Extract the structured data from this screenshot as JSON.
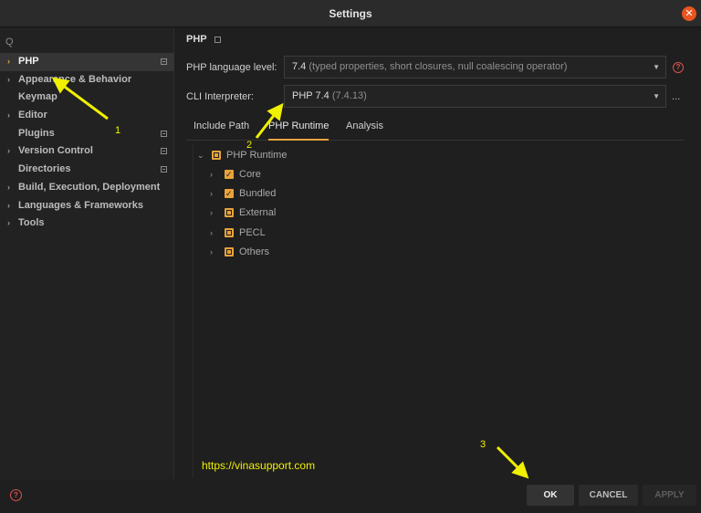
{
  "window": {
    "title": "Settings",
    "close_glyph": "✕"
  },
  "sidebar": {
    "search_icon": "Q",
    "items": [
      {
        "label": "PHP",
        "has_chevron": true,
        "selected": true,
        "has_badge": true
      },
      {
        "label": "Appearance & Behavior",
        "has_chevron": true,
        "selected": false,
        "has_badge": false
      },
      {
        "label": "Keymap",
        "has_chevron": false,
        "selected": false,
        "has_badge": false
      },
      {
        "label": "Editor",
        "has_chevron": true,
        "selected": false,
        "has_badge": false
      },
      {
        "label": "Plugins",
        "has_chevron": false,
        "selected": false,
        "has_badge": true
      },
      {
        "label": "Version Control",
        "has_chevron": true,
        "selected": false,
        "has_badge": true
      },
      {
        "label": "Directories",
        "has_chevron": false,
        "selected": false,
        "has_badge": true
      },
      {
        "label": "Build, Execution, Deployment",
        "has_chevron": true,
        "selected": false,
        "has_badge": false
      },
      {
        "label": "Languages & Frameworks",
        "has_chevron": true,
        "selected": false,
        "has_badge": false
      },
      {
        "label": "Tools",
        "has_chevron": true,
        "selected": false,
        "has_badge": false
      }
    ]
  },
  "main": {
    "breadcrumb": "PHP",
    "language_level": {
      "label": "PHP language level:",
      "value": "7.4",
      "value_detail": "(typed properties, short closures, null coalescing operator)"
    },
    "cli_interpreter": {
      "label": "CLI Interpreter:",
      "value": "PHP 7.4",
      "value_detail": "(7.4.13)",
      "more_label": "..."
    },
    "tabs": [
      {
        "label": "Include Path",
        "active": false
      },
      {
        "label": "PHP Runtime",
        "active": true
      },
      {
        "label": "Analysis",
        "active": false
      }
    ],
    "tree": {
      "root": {
        "label": "PHP Runtime",
        "expanded": true,
        "state": "partial"
      },
      "children": [
        {
          "label": "Core",
          "state": "checked"
        },
        {
          "label": "Bundled",
          "state": "checked"
        },
        {
          "label": "External",
          "state": "partial"
        },
        {
          "label": "PECL",
          "state": "partial"
        },
        {
          "label": "Others",
          "state": "partial"
        }
      ]
    }
  },
  "footer": {
    "help_glyph": "?",
    "ok_label": "OK",
    "cancel_label": "CANCEL",
    "apply_label": "APPLY"
  },
  "annotations": {
    "url": "https://vinasupport.com",
    "marker_1": "1",
    "marker_2": "2",
    "marker_3": "3",
    "color": "#f0f000"
  },
  "colors": {
    "accent": "#e8a33c",
    "close": "#e95420",
    "help": "#d9534f"
  }
}
